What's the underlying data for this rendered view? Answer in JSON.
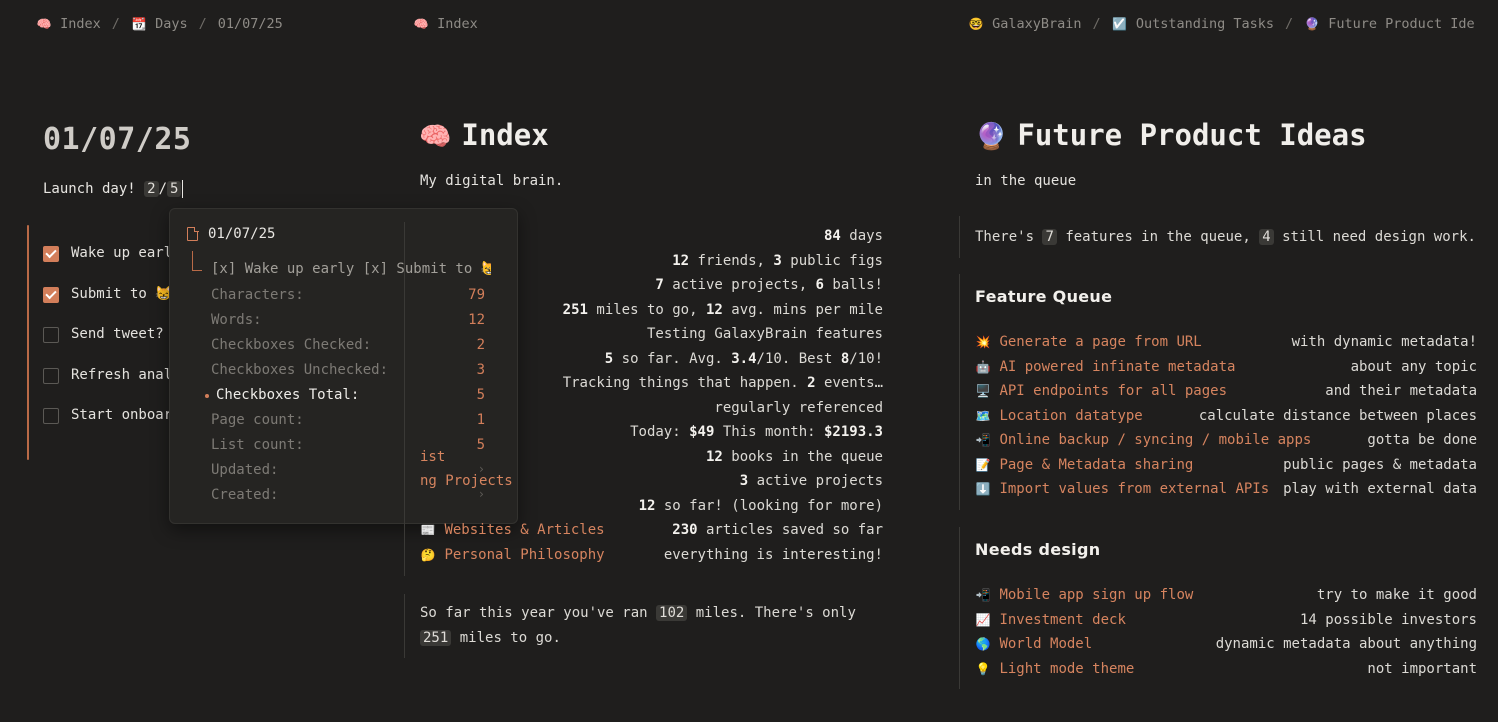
{
  "breadcrumbs_left": [
    {
      "icon": "🧠",
      "label": "Index"
    },
    {
      "icon": "📆",
      "label": "Days"
    },
    {
      "icon": "",
      "label": "01/07/25"
    }
  ],
  "breadcrumbs_middle": [
    {
      "icon": "🧠",
      "label": "Index"
    }
  ],
  "breadcrumbs_right": [
    {
      "icon": "🤓",
      "label": "GalaxyBrain"
    },
    {
      "icon": "☑️",
      "label": "Outstanding Tasks"
    },
    {
      "icon": "🔮",
      "label": "Future Product Ideas"
    }
  ],
  "separator": "/",
  "day": {
    "title": "01/07/25",
    "launch_text": "Launch day!",
    "checked_count": "2",
    "slash": "/",
    "total_count": "5",
    "todos": [
      {
        "label": "Wake up early",
        "checked": true
      },
      {
        "label": "Submit to 😸",
        "checked": true
      },
      {
        "label": "Send tweet?",
        "checked": false
      },
      {
        "label": "Refresh analytics",
        "checked": false
      },
      {
        "label": "Start onboarding",
        "checked": false
      }
    ]
  },
  "popup": {
    "title": "01/07/25",
    "preview": "[x] Wake up early [x] Submit to 😸",
    "stats": [
      {
        "label": "Characters:",
        "value": "79",
        "active": false
      },
      {
        "label": "Words:",
        "value": "12",
        "active": false
      },
      {
        "label": "Checkboxes Checked:",
        "value": "2",
        "active": false
      },
      {
        "label": "Checkboxes Unchecked:",
        "value": "3",
        "active": false
      },
      {
        "label": "Checkboxes Total:",
        "value": "5",
        "active": true
      },
      {
        "label": "Page count:",
        "value": "1",
        "active": false
      },
      {
        "label": "List count:",
        "value": "5",
        "active": false
      },
      {
        "label": "Updated:",
        "value": "",
        "active": false
      },
      {
        "label": "Created:",
        "value": "",
        "active": false
      }
    ]
  },
  "index": {
    "icon": "🧠",
    "title": "Index",
    "subtitle": "My digital brain.",
    "rows": [
      {
        "icon": "",
        "link": "",
        "desc": "<b>84</b> days"
      },
      {
        "icon": "",
        "link": "",
        "desc": "<b>12</b> friends, <b>3</b> public figs"
      },
      {
        "icon": "",
        "link": "",
        "desc": "<b>7</b> active projects, <b>6</b> balls!"
      },
      {
        "icon": "",
        "link": "",
        "desc": "<b>251</b> miles to go, <b>12</b> avg. mins per mile"
      },
      {
        "icon": "",
        "link": "",
        "desc": "Testing GalaxyBrain features"
      },
      {
        "icon": "",
        "link": "",
        "desc": "<b>5</b> so far. Avg. <b>3.4</b>/10. Best <b>8</b>/10!"
      },
      {
        "icon": "",
        "link": "",
        "desc": "Tracking things that happen. <b>2</b> events…"
      },
      {
        "icon": "",
        "link": "",
        "desc": "regularly referenced"
      },
      {
        "icon": "",
        "link": "",
        "desc": "Today: <b>$49</b> This month: <b>$2193.3</b>"
      },
      {
        "icon": "",
        "link": "ist",
        "desc": "<b>12</b> books in the queue"
      },
      {
        "icon": "",
        "link": "ng Projects",
        "desc": "<b>3</b> active projects"
      },
      {
        "icon": "",
        "link": "",
        "desc": "<b>12</b> so far! (looking for more)"
      },
      {
        "icon": "📰",
        "link": "Websites & Articles",
        "desc": "<b>230</b> articles saved so far"
      },
      {
        "icon": "🤔",
        "link": "Personal Philosophy",
        "desc": "everything is interesting!"
      }
    ],
    "runs_callout": {
      "pre": "So far this year you've ran",
      "ran": "102",
      "mid": "miles. There's only",
      "togo": "251",
      "post": "miles to go."
    }
  },
  "future": {
    "icon": "🔮",
    "title": "Future Product Ideas",
    "subtitle": "in the queue",
    "callout": {
      "pre": "There's",
      "features": "7",
      "mid": "features in the queue,",
      "design": "4",
      "post": "still need design work."
    },
    "queue_title": "Feature Queue",
    "queue": [
      {
        "icon": "💥",
        "link": "Generate a page from URL",
        "desc": "with dynamic metadata!"
      },
      {
        "icon": "🤖",
        "link": "AI powered infinate metadata",
        "desc": "about any topic"
      },
      {
        "icon": "🖥️",
        "link": "API endpoints for all pages",
        "desc": "and their metadata"
      },
      {
        "icon": "🗺️",
        "link": "Location datatype",
        "desc": "calculate distance between places"
      },
      {
        "icon": "📲",
        "link": "Online backup / syncing / mobile apps",
        "desc": "gotta be done"
      },
      {
        "icon": "📝",
        "link": "Page & Metadata sharing",
        "desc": "public pages & metadata"
      },
      {
        "icon": "⬇️",
        "link": "Import values from external APIs",
        "desc": "play with external data"
      }
    ],
    "design_title": "Needs design",
    "design": [
      {
        "icon": "📲",
        "link": "Mobile app sign up flow",
        "desc": "try to make it good"
      },
      {
        "icon": "📈",
        "link": "Investment deck",
        "desc": "14 possible investors"
      },
      {
        "icon": "🌎",
        "link": "World Model",
        "desc": "dynamic metadata about anything"
      },
      {
        "icon": "💡",
        "link": "Light mode theme",
        "desc": "not important"
      }
    ]
  }
}
